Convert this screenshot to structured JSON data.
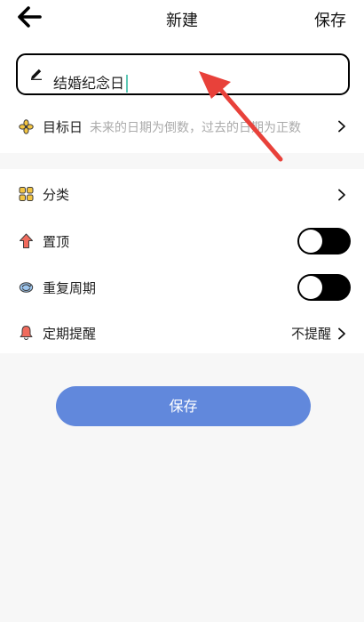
{
  "header": {
    "title": "新建",
    "save_label": "保存"
  },
  "name_input": {
    "value": "结婚纪念日"
  },
  "target_date": {
    "label": "目标日",
    "hint": "未来的日期为倒数，过去的日期为正数"
  },
  "settings": {
    "category_label": "分类",
    "pin_label": "置顶",
    "pin_enabled": false,
    "repeat_label": "重复周期",
    "repeat_enabled": false,
    "reminder_label": "定期提醒",
    "reminder_value": "不提醒"
  },
  "footer": {
    "save_label": "保存"
  },
  "colors": {
    "primary_button": "#6188dc",
    "toggle_off": "#000000",
    "annotation_arrow": "#e8413a"
  }
}
